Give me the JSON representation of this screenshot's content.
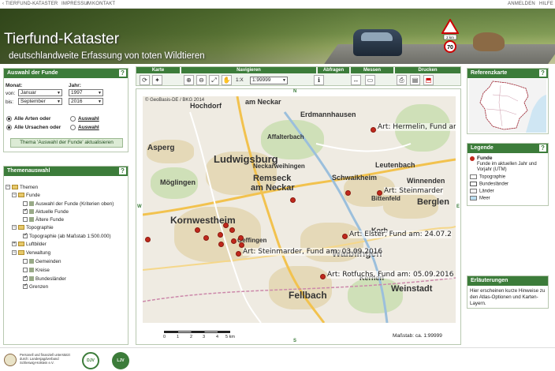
{
  "topbar": {
    "left_link": "‹ TIERFUND-KATASTER",
    "impressum": "IMPRESSUM",
    "sep": "/",
    "kontakt": "KONTAKT",
    "anmelden": "ANMELDEN",
    "hilfe": "HILFE"
  },
  "header": {
    "title": "Tierfund-Kataster",
    "subtitle": "deutschlandweite Erfassung von toten Wildtieren",
    "sign_text": "2 km"
  },
  "auswahl": {
    "title": "Auswahl der Funde",
    "monat_label": "Monat:",
    "jahr_label": "Jahr:",
    "von_label": "von:",
    "bis_label": "bis:",
    "von_monat": "Januar",
    "bis_monat": "September",
    "von_jahr": "1997",
    "bis_jahr": "2016",
    "alle_arten": "Alle Arten oder",
    "alle_ursachen": "Alle Ursachen oder",
    "auswahl_link": "Auswahl",
    "update_button": "Thema 'Auswahl der Funde' aktualisieren"
  },
  "themen": {
    "title": "Themenauswahl",
    "root": "Themen",
    "funde": "Funde",
    "funde_items": [
      "Auswahl der Funde (Kriterien oben)",
      "Aktuelle Funde",
      "Ältere Funde"
    ],
    "topographie": "Topographie",
    "topo_item": "Topographie (ab Maßstab 1:500.000)",
    "luftbilder": "Luftbilder",
    "verwaltung": "Verwaltung",
    "verwaltung_items": [
      "Gemeinden",
      "Kreise",
      "Bundesländer",
      "Grenzen"
    ]
  },
  "toolbar": {
    "karte": "Karte",
    "navigieren": "Navigieren",
    "abfragen": "Abfragen",
    "messen": "Messen",
    "drucken": "Drucken",
    "scale_prefix": "1:X",
    "scale_value": "1:99999"
  },
  "map": {
    "copyright": "© GeoBasis-DE / BKG 2014",
    "compass": {
      "n": "N",
      "s": "S",
      "w": "W",
      "e": "E"
    },
    "places": [
      "Hochdorf",
      "am Neckar",
      "Erdmannhausen",
      "Asperg",
      "Ludwigsburg",
      "Remseck",
      "am Neckar",
      "Schwaikheim",
      "Möglingen",
      "Leutenbach",
      "Winnenden",
      "Kornwestheim",
      "Berglen",
      "Korb",
      "Waiblingen",
      "Fellbach",
      "Kernen",
      "Weinstadt",
      "Affalterbach",
      "Bittenfeld",
      "Neckarweihingen",
      "Oeffingen"
    ],
    "labels": [
      "Art: Hermelin, Fund am",
      "Art: Steinmarder",
      "Art: Elster, Fund am: 24.07.2",
      "Art: Steinmarder, Fund am: 03.09.2016",
      "Art: Rotfuchs, Fund am: 05.09.2016"
    ],
    "scale_ticks": [
      "0",
      "1",
      "2",
      "3",
      "4",
      "5 km"
    ],
    "massstab": "Maßstab: ca. 1:99999"
  },
  "referenz": {
    "title": "Referenzkarte"
  },
  "legende": {
    "title": "Legende",
    "funde": "Funde",
    "funde_desc": "Funde im aktuellen Jahr und Vorjahr (UTM)",
    "items": [
      "Topographie",
      "Bundesländer",
      "Länder",
      "Meer"
    ],
    "colors": [
      "#ffffff",
      "#ffffff",
      "#f2f2f2",
      "#b8dcef"
    ]
  },
  "erlaeuterungen": {
    "title": "Erläuterungen",
    "text": "Hier erscheinen kurze Hinweise zu den Atlas-Optionen und Karten-Layern."
  },
  "footer": {
    "sponsor_text": "Personell und finanziell unterstützt durch: Landesjagdverband Schleswig-Holstein e.V.",
    "logo2": "DJV",
    "logo3": "LJV"
  }
}
